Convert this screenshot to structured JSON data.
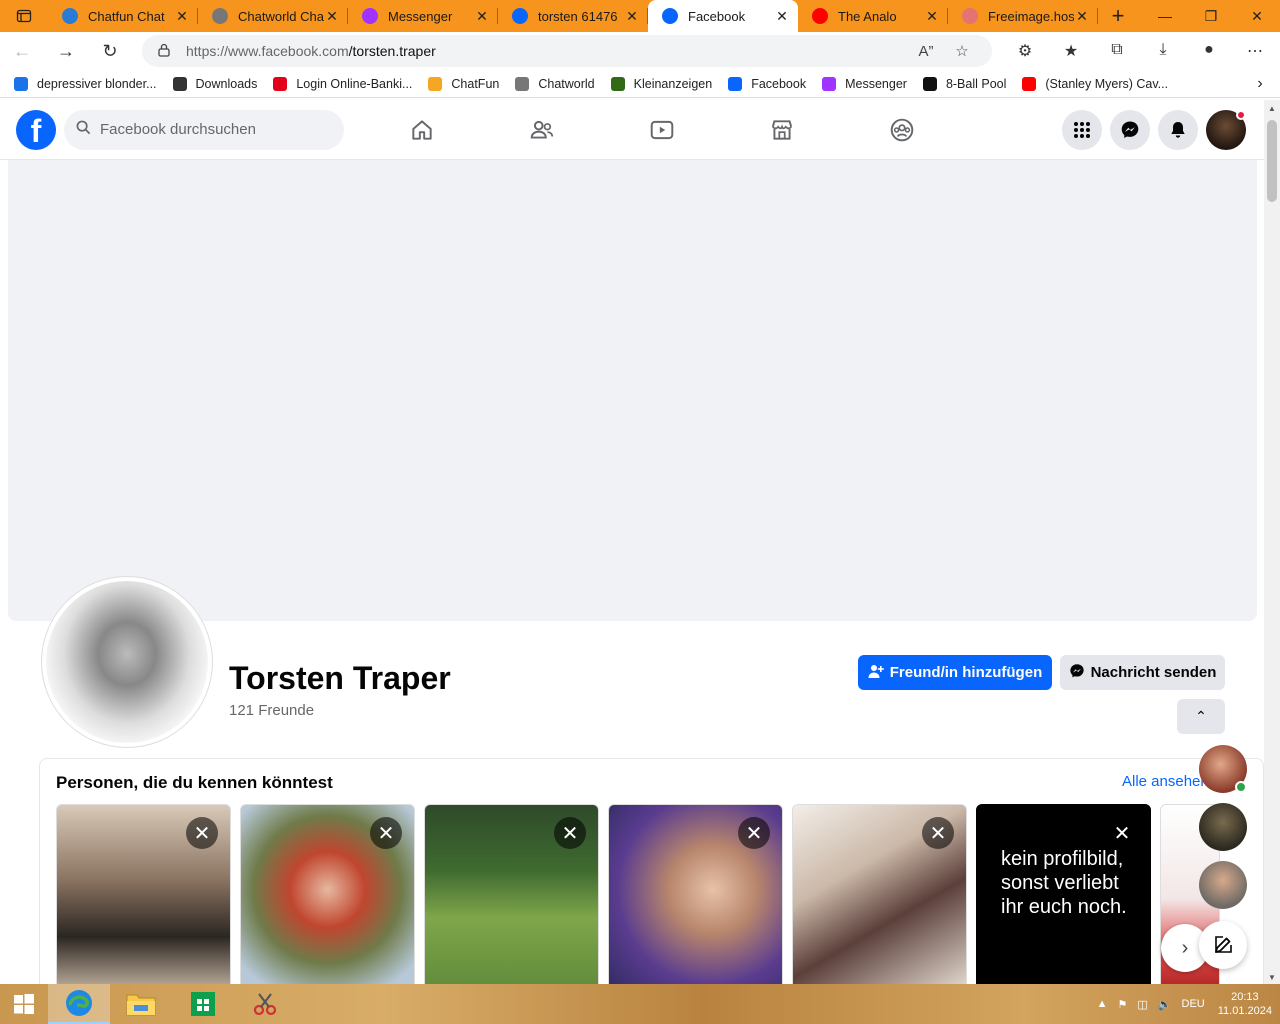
{
  "browser": {
    "tabs": [
      {
        "title": "Chatfun Chat",
        "icon": "chatfun-icon",
        "color": "#2a7bd6"
      },
      {
        "title": "Chatworld Chat",
        "icon": "chatworld-icon",
        "color": "#777777"
      },
      {
        "title": "Messenger",
        "icon": "messenger-icon",
        "color": "#a033ff"
      },
      {
        "title": "torsten 61476",
        "icon": "facebook-icon",
        "color": "#0866ff"
      },
      {
        "title": "Facebook",
        "icon": "facebook-icon",
        "color": "#0866ff",
        "active": true
      },
      {
        "title": "The Analo",
        "icon": "youtube-icon",
        "color": "#ff0000"
      },
      {
        "title": "Freeimage.host",
        "icon": "freeimage-icon",
        "color": "#e57373"
      }
    ],
    "url_domain": "https://www.facebook.com",
    "url_path": "/torsten.traper",
    "bookmarks": [
      {
        "label": "depressiver blonder...",
        "icon": "search-icon",
        "color": "#1a73e8"
      },
      {
        "label": "Downloads",
        "icon": "download-icon",
        "color": "#333333"
      },
      {
        "label": "Login Online-Banki...",
        "icon": "sparkasse-icon",
        "color": "#e3001b"
      },
      {
        "label": "ChatFun",
        "icon": "chatfun-icon",
        "color": "#f5a623"
      },
      {
        "label": "Chatworld",
        "icon": "chatworld-icon",
        "color": "#777777"
      },
      {
        "label": "Kleinanzeigen",
        "icon": "kleinanzeigen-icon",
        "color": "#326916"
      },
      {
        "label": "Facebook",
        "icon": "facebook-icon",
        "color": "#0866ff"
      },
      {
        "label": "Messenger",
        "icon": "messenger-icon",
        "color": "#a033ff"
      },
      {
        "label": "8-Ball Pool",
        "icon": "eightball-icon",
        "color": "#111111"
      },
      {
        "label": "(Stanley Myers) Cav...",
        "icon": "youtube-icon",
        "color": "#ff0000"
      }
    ]
  },
  "facebook": {
    "search_placeholder": "Facebook durchsuchen",
    "profile": {
      "name": "Torsten Traper",
      "friends": "121 Freunde",
      "add_friend": "Freund/in hinzufügen",
      "send_message": "Nachricht senden"
    },
    "pymk": {
      "title": "Personen, die du kennen könntest",
      "see_all": "Alle ansehen",
      "cards": [
        {
          "photo": "couple-mirror-selfie"
        },
        {
          "photo": "red-hair-woman"
        },
        {
          "photo": "man-with-dog"
        },
        {
          "photo": "two-women-selfie"
        },
        {
          "photo": "anime-character"
        },
        {
          "quote": "kein profilbild, sonst verliebt ihr euch noch."
        }
      ]
    }
  },
  "taskbar": {
    "language": "DEU",
    "time": "20:13",
    "date": "11.01.2024"
  },
  "colors": {
    "tabstrip": "#f7941d",
    "facebook_blue": "#0866ff"
  }
}
